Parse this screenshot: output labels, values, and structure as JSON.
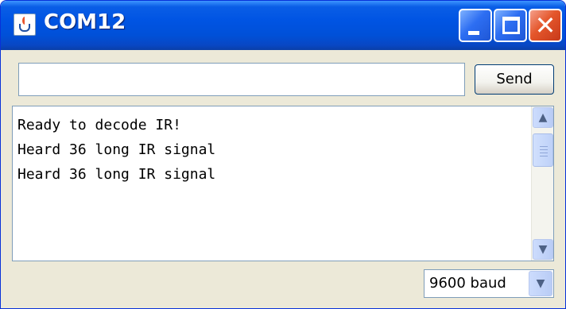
{
  "window": {
    "title": "COM12",
    "icons": {
      "app": "java-cup-icon",
      "minimize": "minimize-icon",
      "maximize": "maximize-icon",
      "close": "close-icon"
    },
    "close_glyph": "✕",
    "colors": {
      "titlebar": "#0054e3",
      "close_button": "#e4562b",
      "window_body": "#ece9d8"
    }
  },
  "send_row": {
    "input_value": "",
    "send_label": "Send"
  },
  "output": {
    "lines": [
      "Ready to decode IR!",
      "Heard 36 long IR signal",
      "Heard 36 long IR signal"
    ],
    "scroll_up_glyph": "▲",
    "scroll_down_glyph": "▼"
  },
  "footer": {
    "baud_value": "9600 baud",
    "dropdown_glyph": "▼"
  }
}
